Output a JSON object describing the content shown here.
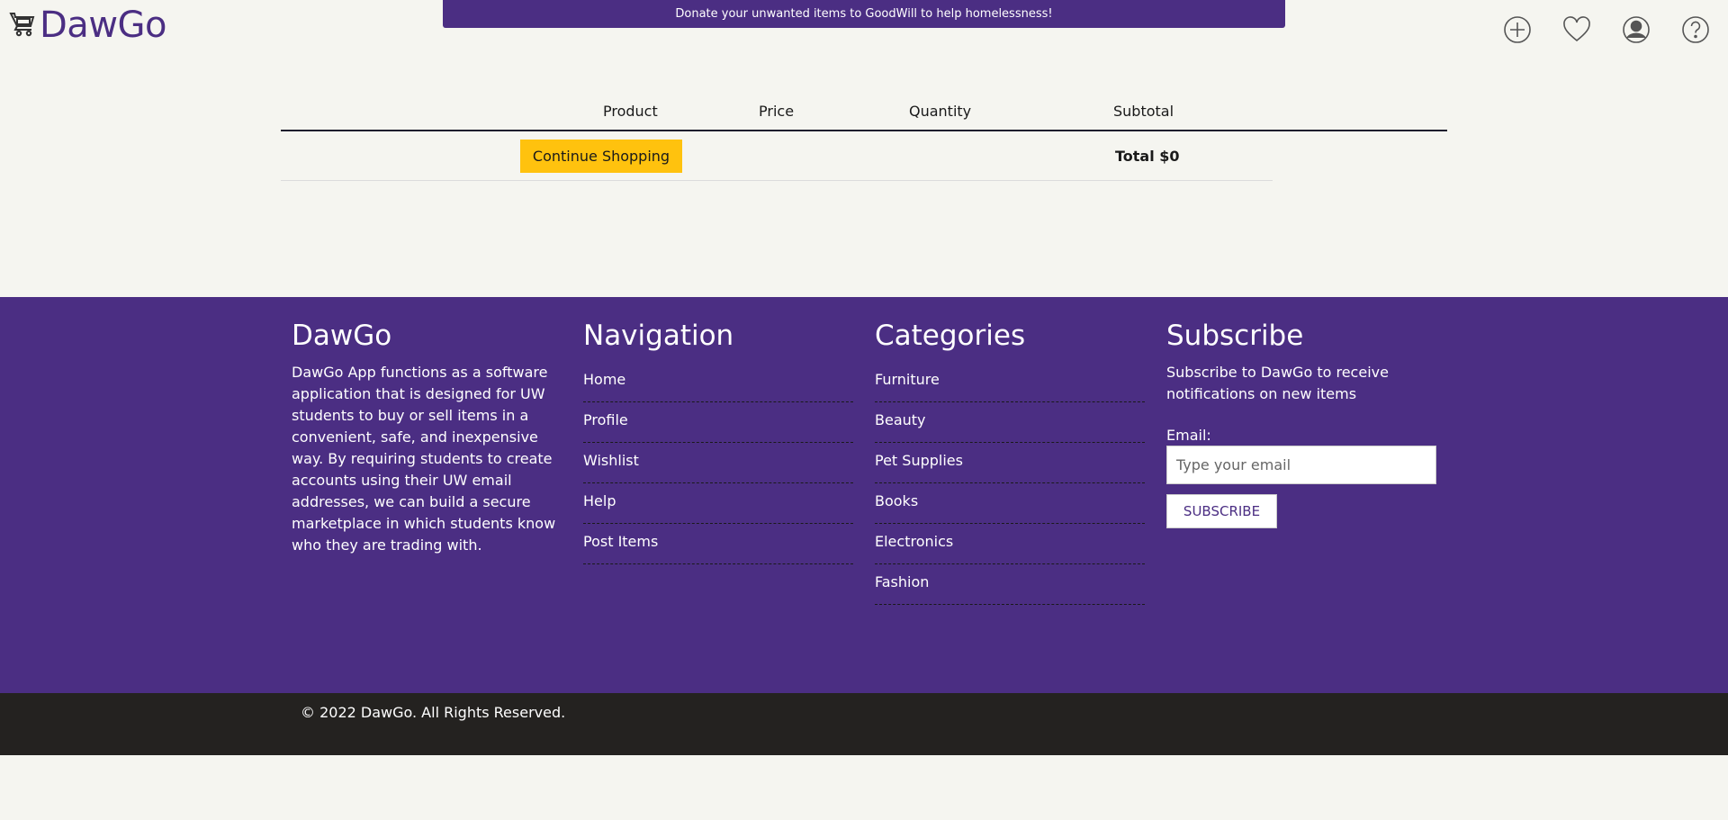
{
  "header": {
    "logo_text": "DawGo",
    "banner": "Donate your unwanted items to GoodWill to help homelessness!",
    "icons": [
      "add-icon",
      "heart-icon",
      "user-icon",
      "help-icon"
    ]
  },
  "cart": {
    "columns": {
      "product": "Product",
      "price": "Price",
      "quantity": "Quantity",
      "subtotal": "Subtotal"
    },
    "continue_label": "Continue Shopping",
    "total_label": "Total $0"
  },
  "footer": {
    "about": {
      "title": "DawGo",
      "text": "DawGo App functions as a software application that is designed for UW students to buy or sell items in a convenient, safe, and inexpensive way. By requiring students to create accounts using their UW email addresses, we can build a secure marketplace in which students know who they are trading with."
    },
    "navigation": {
      "title": "Navigation",
      "items": [
        "Home",
        "Profile",
        "Wishlist",
        "Help",
        "Post Items"
      ]
    },
    "categories": {
      "title": "Categories",
      "items": [
        "Furniture",
        "Beauty",
        "Pet Supplies",
        "Books",
        "Electronics",
        "Fashion"
      ]
    },
    "subscribe": {
      "title": "Subscribe",
      "text": "Subscribe to DawGo to receive notifications on new items",
      "email_label": "Email:",
      "email_placeholder": "Type your email",
      "button_label": "SUBSCRIBE"
    },
    "copyright": "© 2022 DawGo. All Rights Reserved."
  },
  "colors": {
    "brand_purple": "#4b2e83",
    "accent_gold": "#ffc20e",
    "background": "#f5f5f0",
    "bottom_bar": "#242220"
  }
}
